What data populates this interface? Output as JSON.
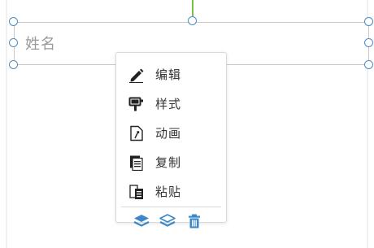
{
  "field": {
    "placeholder": "姓名"
  },
  "menu": {
    "items": [
      {
        "label": "编辑",
        "icon": "edit-pencil-icon"
      },
      {
        "label": "样式",
        "icon": "style-brush-icon"
      },
      {
        "label": "动画",
        "icon": "animation-icon"
      },
      {
        "label": "复制",
        "icon": "copy-icon"
      },
      {
        "label": "粘贴",
        "icon": "paste-icon"
      }
    ],
    "toolbar": [
      {
        "icon": "layer-up-icon"
      },
      {
        "icon": "layer-down-icon"
      },
      {
        "icon": "delete-trash-icon"
      }
    ]
  },
  "colors": {
    "accent": "#3a88c8",
    "handle": "#4d8cc5",
    "rotate_stem": "#7ac143",
    "menu_text": "#333333",
    "placeholder_text": "#9a9a9a"
  }
}
